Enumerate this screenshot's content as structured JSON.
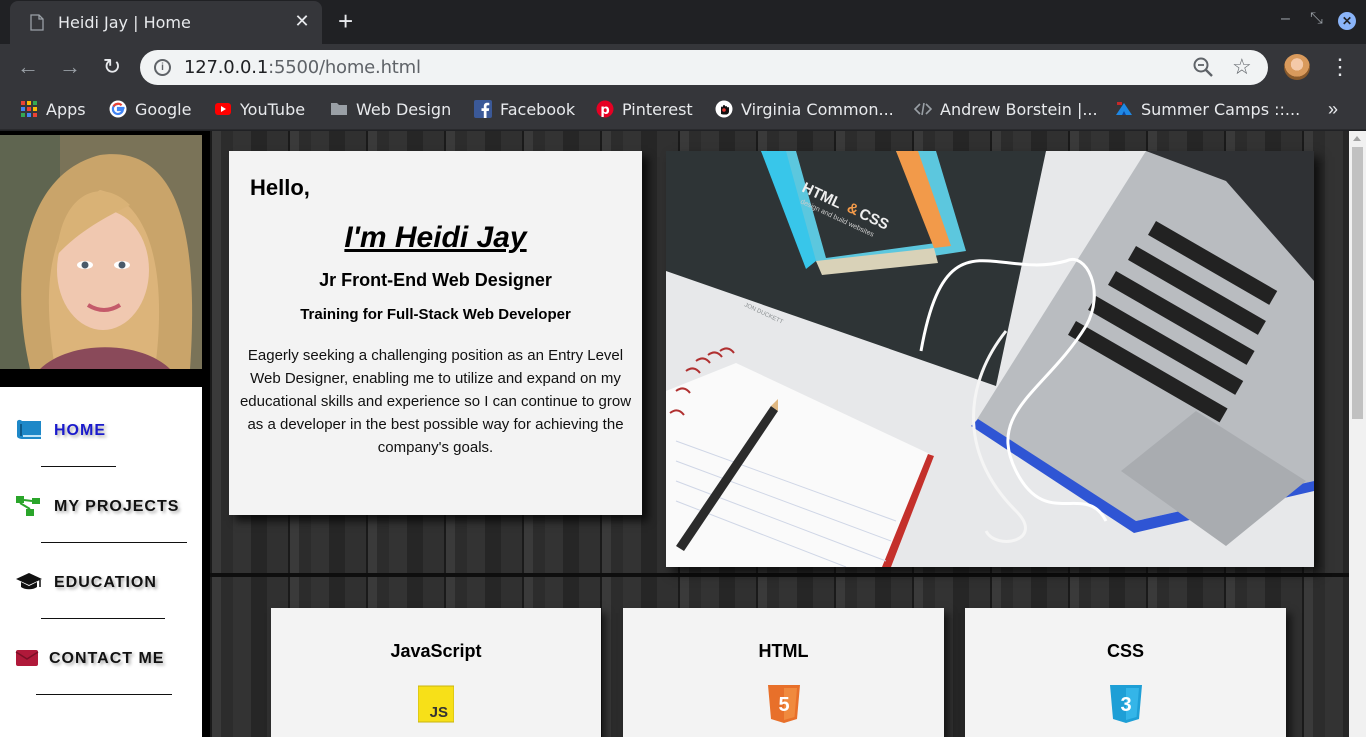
{
  "browser": {
    "tab_title": "Heidi Jay | Home",
    "tab_close": "✕",
    "new_tab": "+",
    "url_host": "127.0.0.1",
    "url_rest": ":5500/home.html",
    "bookmarks": [
      {
        "label": "Apps",
        "icon": "apps-grid-icon"
      },
      {
        "label": "Google",
        "icon": "google-icon"
      },
      {
        "label": "YouTube",
        "icon": "youtube-icon"
      },
      {
        "label": "Web Design",
        "icon": "folder-icon"
      },
      {
        "label": "Facebook",
        "icon": "facebook-icon"
      },
      {
        "label": "Pinterest",
        "icon": "pinterest-icon"
      },
      {
        "label": "Virginia Common...",
        "icon": "hand-icon"
      },
      {
        "label": "Andrew Borstein |...",
        "icon": "code-icon"
      },
      {
        "label": "Summer Camps ::...",
        "icon": "camp-icon"
      }
    ],
    "bookmarks_more": "»"
  },
  "sidebar": {
    "nav": [
      {
        "label": "HOME",
        "icon": "book-icon",
        "active": true
      },
      {
        "label": "MY PROJECTS",
        "icon": "sitemap-icon",
        "active": false
      },
      {
        "label": "EDUCATION",
        "icon": "graduation-cap-icon",
        "active": false
      },
      {
        "label": "CONTACT ME",
        "icon": "envelope-icon",
        "active": false
      }
    ]
  },
  "intro": {
    "greeting": "Hello,",
    "name": "I'm Heidi Jay",
    "role": "Jr Front-End Web Designer",
    "training": "Training for Full-Stack Web Developer",
    "bio": "Eagerly seeking a challenging position as an Entry Level Web Designer, enabling me to utilize and expand on my educational skills and experience so I can continue to grow as a developer in the best possible way for achieving the company's goals."
  },
  "hero_book": {
    "title_a": "HTML",
    "title_amp": "&",
    "title_b": "CSS",
    "subtitle": "design and build websites",
    "author": "JON DUCKETT"
  },
  "skills": [
    {
      "title": "JavaScript",
      "icon": "javascript-logo-icon",
      "badge": "JS"
    },
    {
      "title": "HTML",
      "icon": "html5-logo-icon",
      "badge": "5"
    },
    {
      "title": "CSS",
      "icon": "css3-logo-icon",
      "badge": "3"
    }
  ],
  "colors": {
    "active_nav": "#1a1acc",
    "card_bg": "#f3f3f3",
    "js_yellow": "#f7e018",
    "html_orange": "#e8702a",
    "css_blue": "#1e9fd6"
  }
}
